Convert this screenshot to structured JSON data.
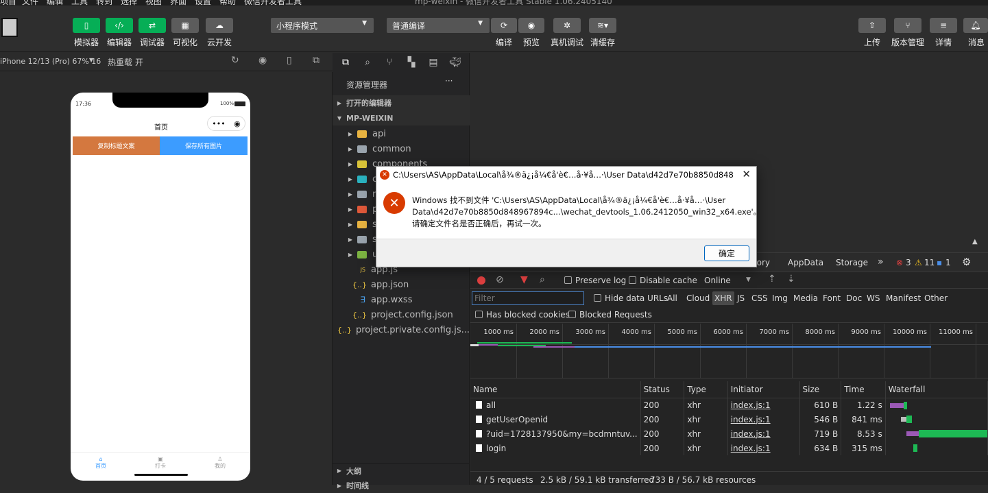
{
  "menubar": [
    "项目",
    "文件",
    "编辑",
    "工具",
    "转到",
    "选择",
    "视图",
    "界面",
    "设置",
    "帮助",
    "微信开发者工具"
  ],
  "window_title": "mp-weixin - 微信开发者工具 Stable 1.06.2405140",
  "toolbar": {
    "left_buttons": [
      "模拟器",
      "编辑器",
      "调试器",
      "可视化",
      "云开发"
    ],
    "mode_select": "小程序模式",
    "compile_select": "普通编译",
    "center_buttons": [
      "编译",
      "预览",
      "真机调试",
      "清缓存"
    ],
    "right_buttons": [
      "上传",
      "版本管理",
      "详情",
      "消息"
    ]
  },
  "simulator": {
    "device": "iPhone 12/13 (Pro) 67% 16",
    "hot_reload": "热重载 开",
    "status_time": "17:36",
    "battery": "100%",
    "nav_title": "首页",
    "btn_copy": "复制标题文案",
    "btn_save": "保存所有图片",
    "tabs": [
      "首页",
      "打卡",
      "我的"
    ]
  },
  "explorer": {
    "header": "资源管理器",
    "more": "···",
    "open_editors": "打开的编辑器",
    "project": "MP-WEIXIN",
    "items": [
      "api",
      "common",
      "components",
      "c",
      "n",
      "p",
      "s",
      "s",
      "u",
      "app.js",
      "app.json",
      "app.wxss",
      "project.config.json",
      "project.private.config.js..."
    ],
    "outline": "大纲",
    "timeline": "时间线"
  },
  "devtools": {
    "tabs": [
      "nory",
      "AppData",
      "Storage"
    ],
    "errors": "3",
    "warnings": "11",
    "infos": "1",
    "preserve_log": "Preserve log",
    "disable_cache": "Disable cache",
    "online": "Online",
    "filter_placeholder": "Filter",
    "hide_data_urls": "Hide data URLs",
    "type_filters": [
      "All",
      "Cloud",
      "XHR",
      "JS",
      "CSS",
      "Img",
      "Media",
      "Font",
      "Doc",
      "WS",
      "Manifest",
      "Other"
    ],
    "has_blocked_cookies": "Has blocked cookies",
    "blocked_requests": "Blocked Requests",
    "timeline_ticks": [
      "1000 ms",
      "2000 ms",
      "3000 ms",
      "4000 ms",
      "5000 ms",
      "6000 ms",
      "7000 ms",
      "8000 ms",
      "9000 ms",
      "10000 ms",
      "11000 ms"
    ],
    "columns": [
      "Name",
      "Status",
      "Type",
      "Initiator",
      "Size",
      "Time",
      "Waterfall"
    ],
    "rows": [
      {
        "name": "all",
        "status": "200",
        "type": "xhr",
        "initiator": "index.js:1",
        "size": "610 B",
        "time": "1.22 s"
      },
      {
        "name": "getUserOpenid",
        "status": "200",
        "type": "xhr",
        "initiator": "index.js:1",
        "size": "546 B",
        "time": "841 ms"
      },
      {
        "name": "?uid=1728137950&my=bcdmntuv...",
        "status": "200",
        "type": "xhr",
        "initiator": "index.js:1",
        "size": "719 B",
        "time": "8.53 s"
      },
      {
        "name": "login",
        "status": "200",
        "type": "xhr",
        "initiator": "index.js:1",
        "size": "634 B",
        "time": "315 ms"
      }
    ],
    "summary": [
      "4 / 5 requests",
      "2.5 kB / 59.1 kB transferred",
      "733 B / 56.7 kB resources"
    ]
  },
  "dialog": {
    "title": "C:\\Users\\AS\\AppData\\Local\\å¾®ä¿¡å¼€å'è€…å·¥å…·\\User Data\\d42d7e70b8850d84896789...",
    "line1": "Windows 找不到文件 'C:\\Users\\AS\\AppData\\Local\\å¾®ä¿¡å¼€å'è€…å·¥å…·\\User",
    "line2": "Data\\d42d7e70b8850d848967894c...\\wechat_devtools_1.06.2412050_win32_x64.exe'。",
    "line3": "请确定文件名是否正确后，再试一次。",
    "ok": "确定"
  },
  "colors": {
    "green": "#06ae56",
    "copy_btn": "#d4783f",
    "save_btn": "#3c9cff",
    "accent": "#d83b01"
  }
}
